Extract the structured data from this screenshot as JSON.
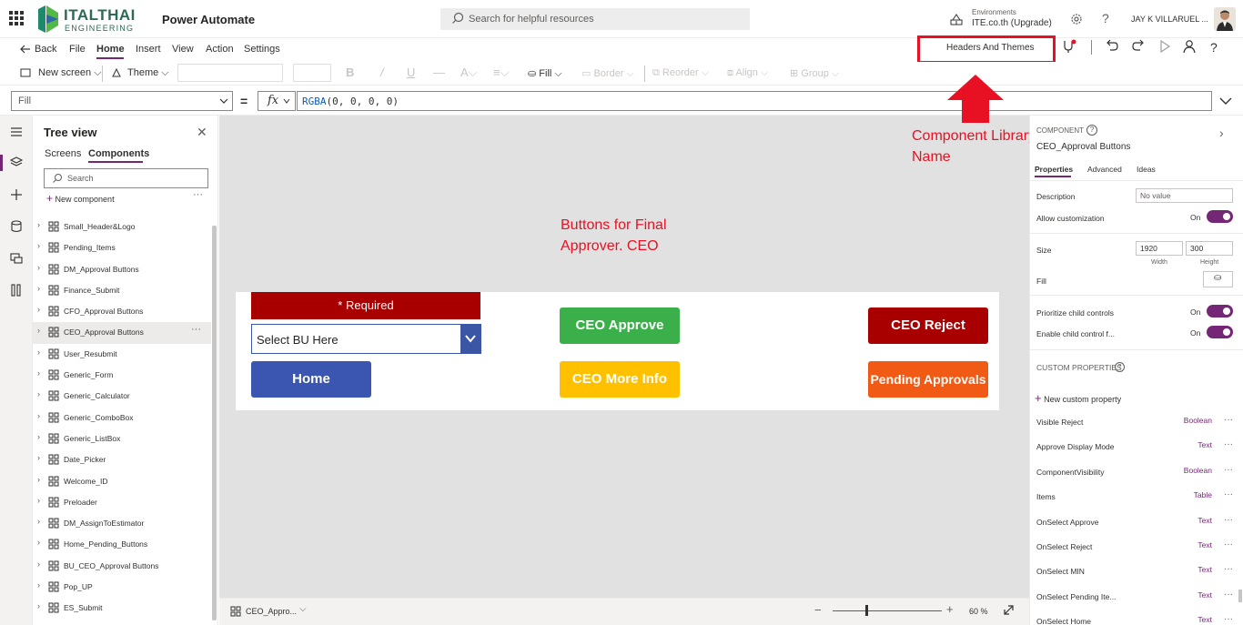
{
  "topbar": {
    "logo_name": "ITALTHAI",
    "logo_sub": "ENGINEERING",
    "app_name": "Power Automate",
    "search_placeholder": "Search for helpful resources",
    "env_label": "Environments",
    "env_name": "ITE.co.th (Upgrade)",
    "help": "?",
    "user_name": "JAY K VILLARUEL ..."
  },
  "menu": {
    "back": "Back",
    "items": [
      "File",
      "Home",
      "Insert",
      "View",
      "Action",
      "Settings"
    ],
    "active": "Home",
    "library_name": "Headers And Themes"
  },
  "toolbar": {
    "new_screen": "New screen",
    "theme": "Theme",
    "fill": "Fill",
    "border": "Border",
    "reorder": "Reorder",
    "align": "Align",
    "group": "Group"
  },
  "formula": {
    "property": "Fill",
    "equals": "=",
    "fx": "fx",
    "fn_name": "RGBA",
    "args": "(0, 0, 0, 0)"
  },
  "tree": {
    "title": "Tree view",
    "tab_screens": "Screens",
    "tab_components": "Components",
    "search_placeholder": "Search",
    "new_component": "New component",
    "items": [
      "Small_Header&Logo",
      "Pending_Items",
      "DM_Approval Buttons",
      "Finance_Submit",
      "CFO_Approval Buttons",
      "CEO_Approval Buttons",
      "User_Resubmit",
      "Generic_Form",
      "Generic_Calculator",
      "Generic_ComboBox",
      "Generic_ListBox",
      "Date_Picker",
      "Welcome_ID",
      "Preloader",
      "DM_AssignToEstimator",
      "Home_Pending_Buttons",
      "BU_CEO_Approval Buttons",
      "Pop_UP",
      "ES_Submit"
    ],
    "selected": "CEO_Approval Buttons"
  },
  "canvas": {
    "required": "* Required",
    "bu_dropdown": "Select BU Here",
    "home": "Home",
    "ceo_approve": "CEO Approve",
    "ceo_more_info": "CEO More Info",
    "ceo_reject": "CEO Reject",
    "pending_approvals": "Pending Approvals",
    "note_buttons": "Buttons for Final Approver. CEO",
    "note_library": "Component Library Name",
    "colors": {
      "required": "#a80000",
      "home": "#3a56b0",
      "approve": "#3bb04a",
      "more_info": "#ffc000",
      "reject": "#a80000",
      "pending": "#f05a14",
      "annotation": "#e81123"
    }
  },
  "bottom": {
    "component": "CEO_Appro...",
    "zoom": "60 %",
    "zoom_fraction": 0.3
  },
  "props": {
    "kind": "COMPONENT",
    "help": "?",
    "name": "CEO_Approval Buttons",
    "tabs": [
      "Properties",
      "Advanced",
      "Ideas"
    ],
    "description_label": "Description",
    "description_placeholder": "No value",
    "allow_customization": "Allow customization",
    "allow_state": "On",
    "size_label": "Size",
    "width": "1920",
    "height": "300",
    "width_caption": "Width",
    "height_caption": "Height",
    "fill_label": "Fill",
    "prioritize": "Prioritize child controls",
    "prioritize_state": "On",
    "enable_child": "Enable child control f...",
    "enable_state": "On",
    "custom_title": "CUSTOM PROPERTIES",
    "new_custom": "New custom property",
    "custom": [
      {
        "name": "Visible Reject",
        "type": "Boolean"
      },
      {
        "name": "Approve Display Mode",
        "type": "Text"
      },
      {
        "name": "ComponentVisibility",
        "type": "Boolean"
      },
      {
        "name": "Items",
        "type": "Table"
      },
      {
        "name": "OnSelect Approve",
        "type": "Text"
      },
      {
        "name": "OnSelect Reject",
        "type": "Text"
      },
      {
        "name": "OnSelect MIN",
        "type": "Text"
      },
      {
        "name": "OnSelect Pending Ite...",
        "type": "Text"
      },
      {
        "name": "OnSelect Home",
        "type": "Text"
      }
    ]
  }
}
